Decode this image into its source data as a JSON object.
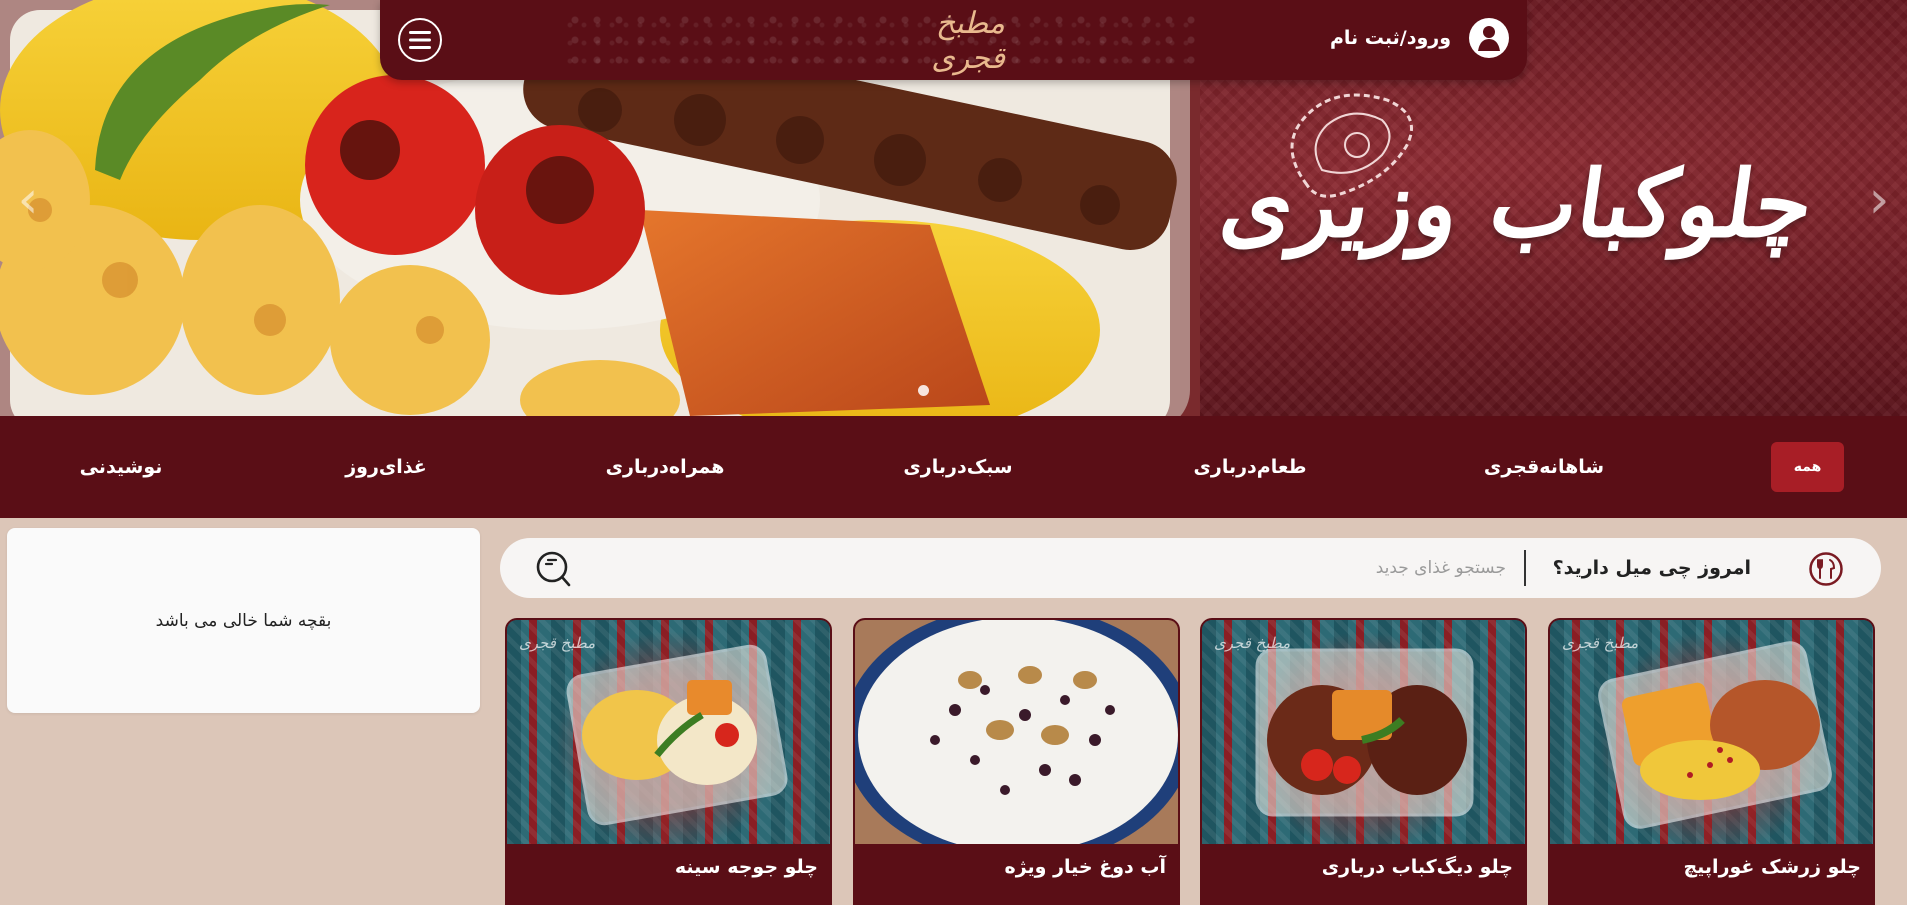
{
  "hero": {
    "title": "چلوکباب وزیری",
    "prev_arrow": "‹",
    "next_arrow": "›"
  },
  "topbar": {
    "logo_text": "مطبخ قجری",
    "login_label": "ورود/ثبت نام"
  },
  "categories": {
    "all_label": "همه",
    "items": [
      {
        "label": "شاهانه‌قجری"
      },
      {
        "label": "طعام‌درباری"
      },
      {
        "label": "سبک‌درباری"
      },
      {
        "label": "همراه‌درباری"
      },
      {
        "label": "غذای‌روز"
      },
      {
        "label": "نوشیدنی"
      }
    ]
  },
  "cart": {
    "empty_text": "بقچه شما خالی می باشد"
  },
  "search": {
    "question": "امروز چی میل دارید؟",
    "placeholder": "جستجو غذای جدید",
    "value": ""
  },
  "products": [
    {
      "title": "چلو زرشک غوراپیچ"
    },
    {
      "title": "چلو دیگ‌کباب درباری"
    },
    {
      "title": "آب دوغ خیار ویژه"
    },
    {
      "title": "چلو جوجه سینه"
    }
  ],
  "colors": {
    "brand_dark": "#5a0e16",
    "accent": "#a81e26",
    "page_bg": "#dcc6b8"
  }
}
